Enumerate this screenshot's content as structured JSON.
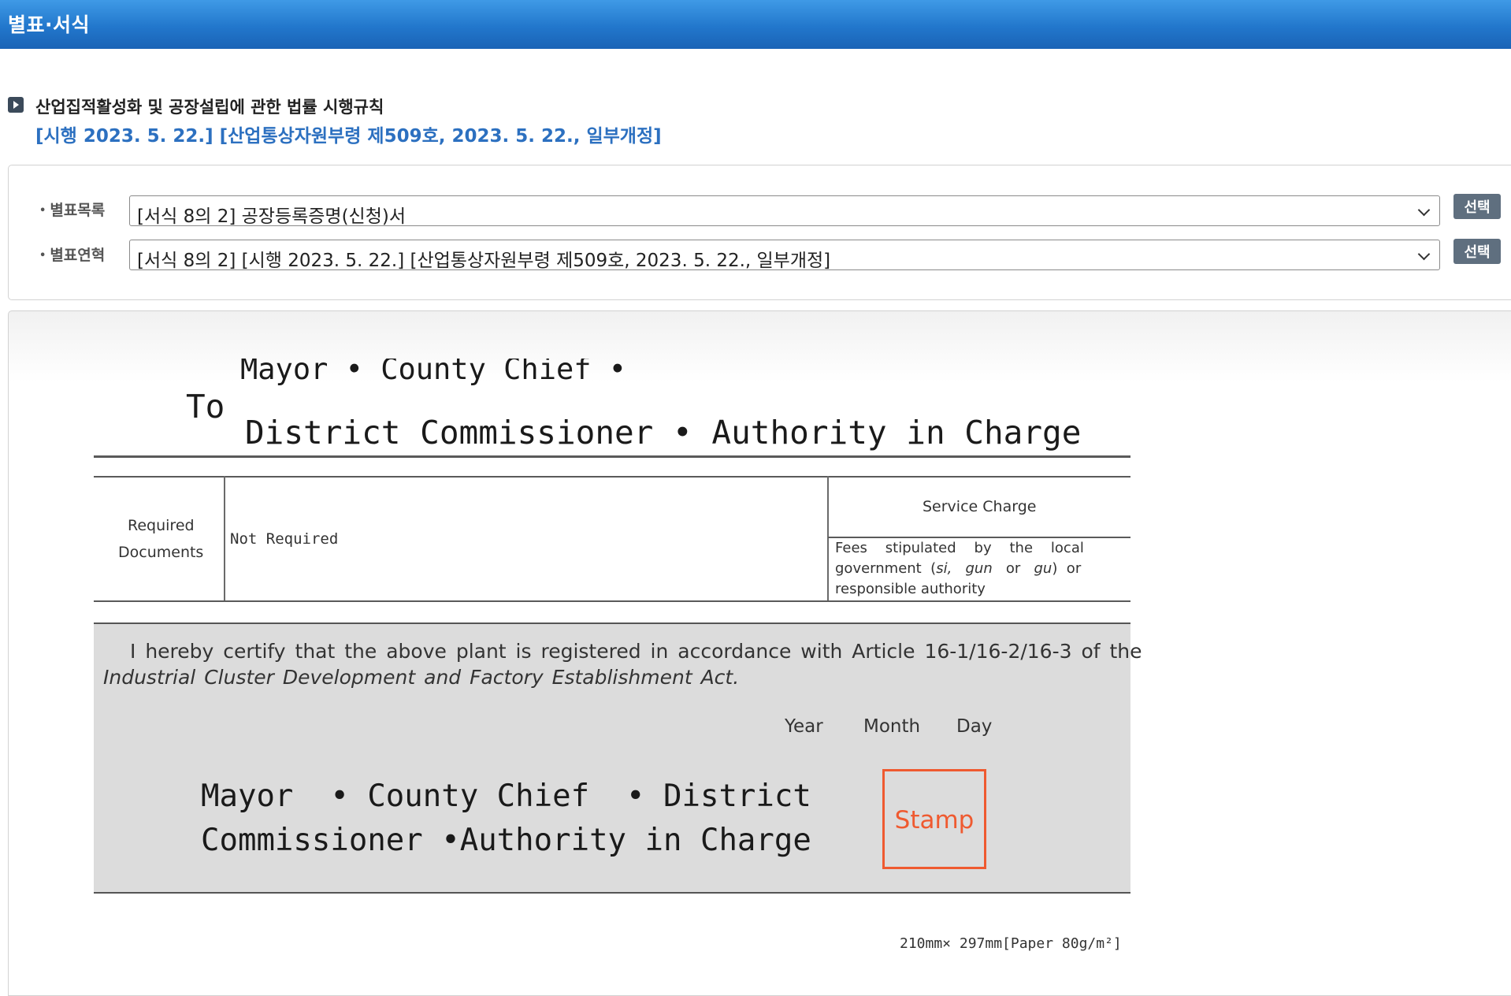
{
  "header": {
    "title": "별표·서식"
  },
  "law": {
    "title": "산업집적활성화 및 공장설립에 관한 법률 시행규칙",
    "subtitle": "[시행 2023. 5. 22.] [산업통상자원부령 제509호, 2023. 5. 22., 일부개정]"
  },
  "selectors": {
    "list_label": "별표목록",
    "list_value": "[서식 8의 2] 공장등록증명(신청)서",
    "history_label": "별표연혁",
    "history_value": "[서식 8의 2] [시행 2023. 5. 22.] [산업통상자원부령 제509호, 2023. 5. 22., 일부개정]",
    "button_label": "선택"
  },
  "form": {
    "to_label": "To",
    "to_line1": "Mayor  • County Chief  •",
    "to_line2": "District Commissioner  • Authority in Charge",
    "required_docs_label_1": "Required",
    "required_docs_label_2": "Documents",
    "required_docs_value": "Not Required",
    "service_charge_label": "Service Charge",
    "fees_line1": "Fees    stipulated    by    the    local",
    "fees_line2_a": "government  (",
    "fees_line2_si": "si,",
    "fees_line2_gun": "gun",
    "fees_line2_or1": "or",
    "fees_line2_gu": "gu",
    "fees_line2_or2": ")  or",
    "fees_line3": "responsible authority",
    "certify_line1": "I hereby certify that the above plant is registered in accordance with Article 16-1/16-2/16-3 of the",
    "certify_line2": "Industrial Cluster Development and Factory Establishment Act.",
    "year_label": "Year",
    "month_label": "Month",
    "day_label": "Day",
    "authority_line1": "Mayor  • County Chief  • District",
    "authority_line2": "Commissioner •Authority in Charge",
    "stamp_label": "Stamp",
    "paper_size": "210mm× 297mm[Paper 80g/m²]"
  },
  "colors": {
    "header_blue": "#2277cc",
    "link_blue": "#2c70c0",
    "stamp_orange": "#ef5a30",
    "button_gray": "#5f6f7f"
  }
}
